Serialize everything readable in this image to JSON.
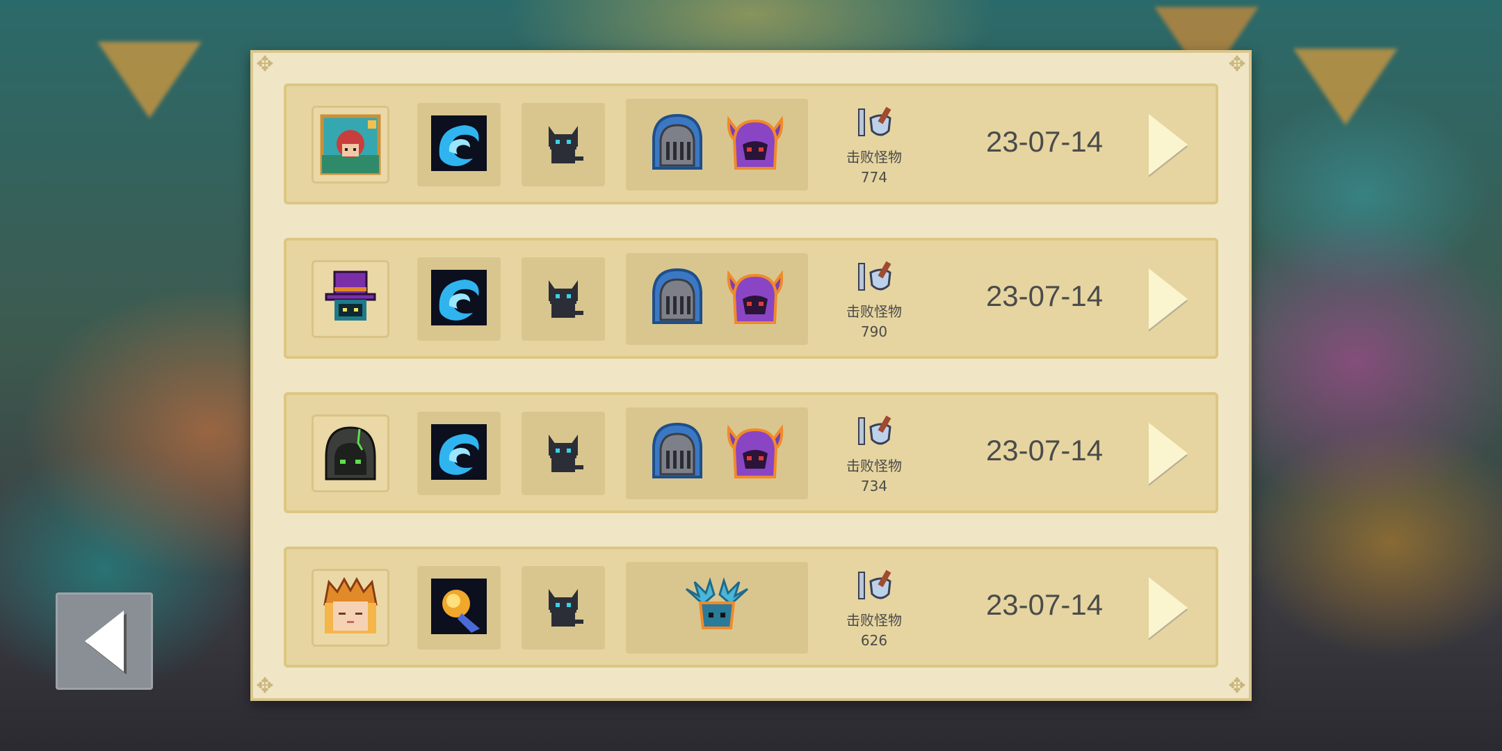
{
  "records": [
    {
      "character_icon": "red-hood-portrait-icon",
      "weapon_icon": "blue-wave-icon",
      "pet_icon": "black-cat-icon",
      "enemies": [
        "knight-helmet-icon",
        "purple-horned-demon-icon"
      ],
      "stat_icon": "sword-shield-icon",
      "stat_label": "击败怪物",
      "stat_value": "774",
      "date": "23-07-14"
    },
    {
      "character_icon": "top-hat-character-icon",
      "weapon_icon": "blue-wave-icon",
      "pet_icon": "black-cat-icon",
      "enemies": [
        "knight-helmet-icon",
        "purple-horned-demon-icon"
      ],
      "stat_icon": "sword-shield-icon",
      "stat_label": "击败怪物",
      "stat_value": "790",
      "date": "23-07-14"
    },
    {
      "character_icon": "dark-hooded-character-icon",
      "weapon_icon": "blue-wave-icon",
      "pet_icon": "black-cat-icon",
      "enemies": [
        "knight-helmet-icon",
        "purple-horned-demon-icon"
      ],
      "stat_icon": "sword-shield-icon",
      "stat_label": "击败怪物",
      "stat_value": "734",
      "date": "23-07-14"
    },
    {
      "character_icon": "golden-headdress-character-icon",
      "weapon_icon": "golden-fist-icon",
      "pet_icon": "black-cat-icon",
      "enemies": [
        "blue-crystal-creature-icon"
      ],
      "stat_icon": "sword-shield-icon",
      "stat_label": "击败怪物",
      "stat_value": "626",
      "date": "23-07-14"
    }
  ],
  "back_icon": "back-arrow-icon"
}
